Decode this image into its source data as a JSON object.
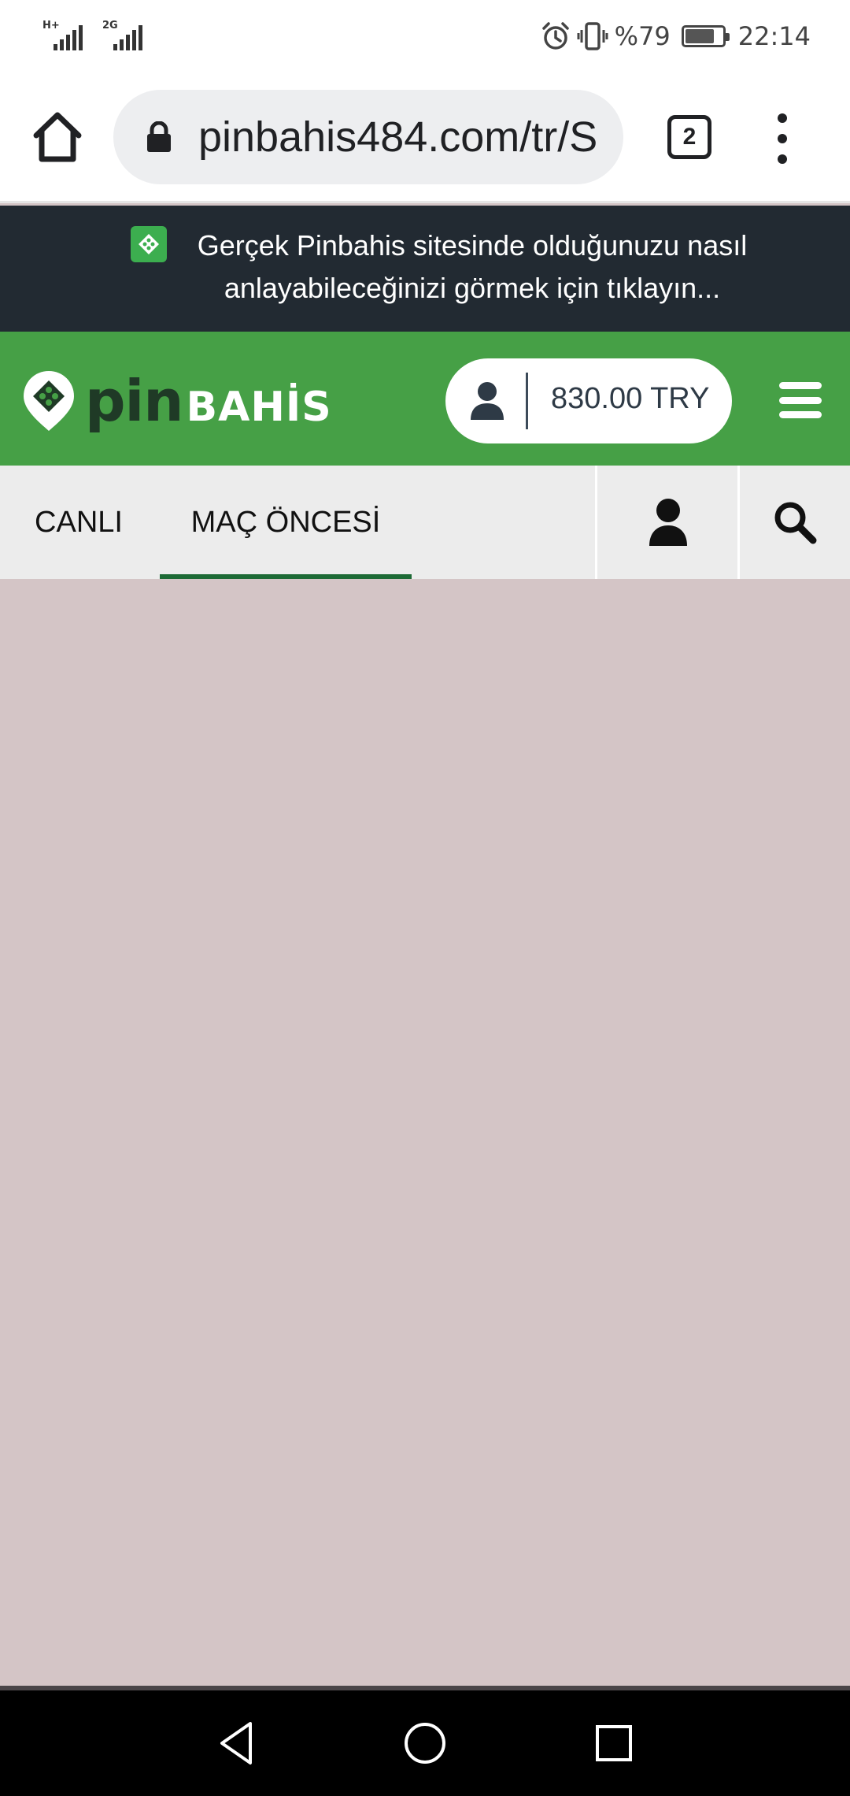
{
  "status_bar": {
    "signal1_label": "H+",
    "signal2_label": "2G",
    "battery_text": "%79",
    "battery_level": 0.79,
    "time": "22:14",
    "icons": [
      "alarm-icon",
      "vibrate-icon",
      "battery-icon"
    ]
  },
  "browser": {
    "url": "pinbahis484.com/tr/S",
    "tab_count": "2",
    "icons": [
      "home-icon",
      "lock-icon",
      "tabs-icon",
      "overflow-menu-icon"
    ]
  },
  "banner": {
    "text": "Gerçek Pinbahis sitesinde olduğunuzu nasıl anlayabileceğinizi görmek için tıklayın...",
    "icon": "pinbahis-badge-icon"
  },
  "header": {
    "logo_pin": "pin",
    "logo_bahis": "BAHİS",
    "balance": "830.00 TRY",
    "colors": {
      "brand_green": "#46a046",
      "logo_dark": "#1f3a26",
      "banner_bg": "#222a32"
    }
  },
  "nav": {
    "tabs": [
      {
        "label": "CANLI",
        "active": false
      },
      {
        "label": "MAÇ ÖNCESİ",
        "active": true
      }
    ],
    "icons": [
      "user-icon",
      "search-icon"
    ],
    "active_indicator_color": "#1d6a35"
  },
  "content": {
    "background": "#d4c5c6"
  },
  "system_nav": {
    "icons": [
      "back-icon",
      "home-circle-icon",
      "recents-icon"
    ]
  }
}
